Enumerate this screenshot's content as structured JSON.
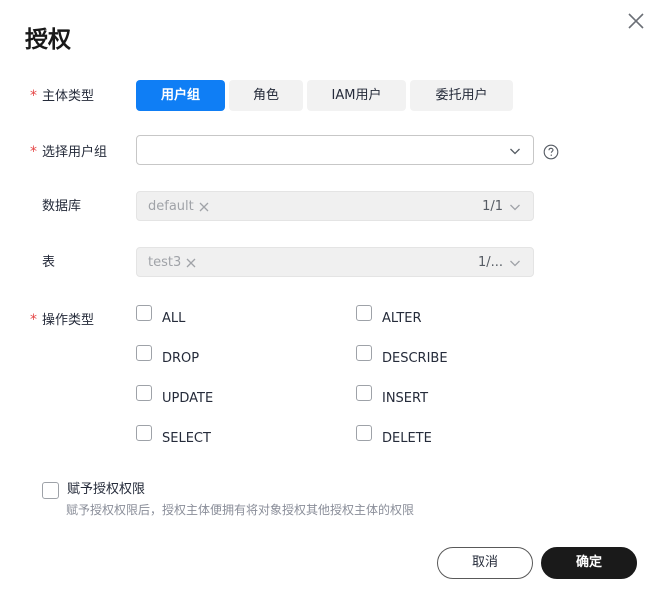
{
  "dialog": {
    "title": "授权"
  },
  "subject_type": {
    "label": "主体类型",
    "required_mark": "*",
    "options": [
      "用户组",
      "角色",
      "IAM用户",
      "委托用户"
    ],
    "selected_index": 0
  },
  "user_group": {
    "label": "选择用户组",
    "required_mark": "*",
    "value": ""
  },
  "database": {
    "label": "数据库",
    "tag": "default",
    "count": "1/1"
  },
  "table": {
    "label": "表",
    "tag": "test3",
    "count": "1/..."
  },
  "operation_type": {
    "label": "操作类型",
    "required_mark": "*",
    "options": [
      "ALL",
      "ALTER",
      "DROP",
      "DESCRIBE",
      "UPDATE",
      "INSERT",
      "SELECT",
      "DELETE"
    ]
  },
  "grant": {
    "label": "赋予授权权限",
    "hint": "赋予授权权限后，授权主体便拥有将对象授权其他授权主体的权限"
  },
  "footer": {
    "cancel_label": "取消",
    "ok_label": "确定"
  },
  "colors": {
    "accent": "#0f7ef5",
    "required": "#e54545",
    "primary_button": "#1a1a1a"
  }
}
